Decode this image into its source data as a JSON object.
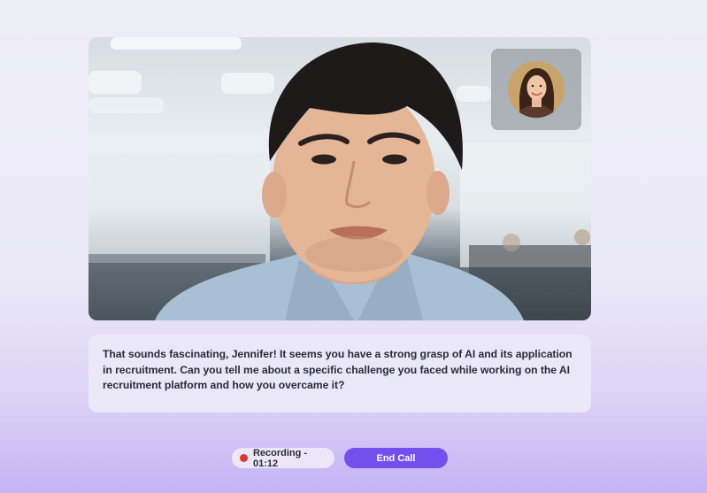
{
  "video": {
    "remote_participant": "interviewee-video",
    "self_view_icon": "avatar-icon"
  },
  "transcript": {
    "text": "That sounds fascinating, Jennifer! It seems you have a strong grasp of AI and its application in recruitment. Can you tell me about a specific challenge you faced while working on the AI recruitment platform and how you overcame it?"
  },
  "controls": {
    "recording_label": "Recording - 01:12",
    "end_call_label": "End Call"
  },
  "colors": {
    "accent": "#7350ee",
    "recording_dot": "#e0342f",
    "transcript_bg": "#eae8f8"
  }
}
